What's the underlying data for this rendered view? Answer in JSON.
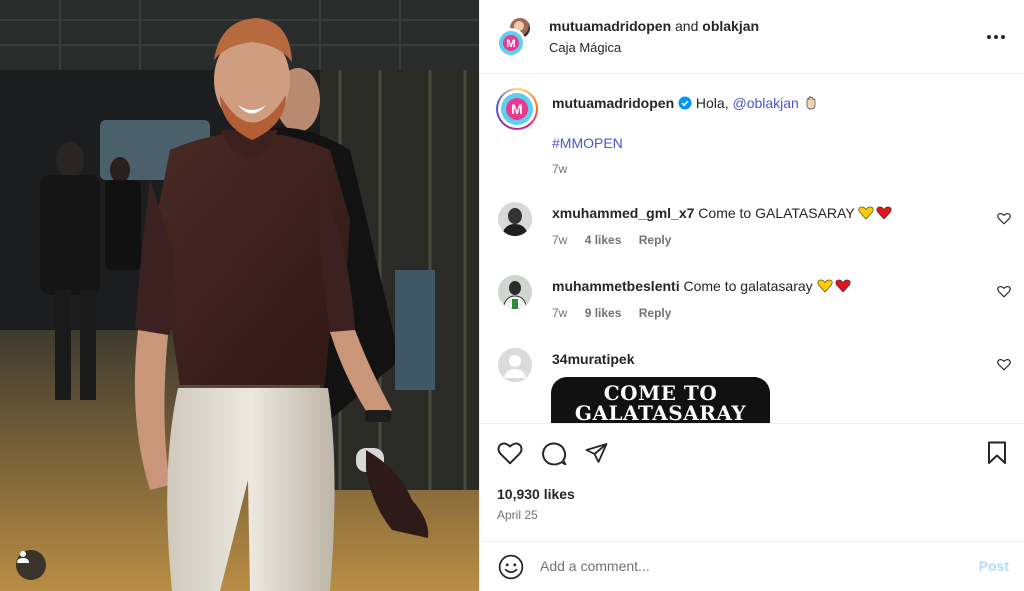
{
  "header": {
    "author1": "mutuamadridopen",
    "connector": "and",
    "author2": "oblakjan",
    "location": "Caja Mágica"
  },
  "caption": {
    "username": "mutuamadridopen",
    "text_before": "Hola,",
    "mention": "@oblakjan",
    "hashtag": "#MMOPEN",
    "time": "7w"
  },
  "comments": [
    {
      "username": "xmuhammed_gml_x7",
      "text": "Come to GALATASARAY",
      "time": "7w",
      "likes": "4 likes",
      "reply": "Reply"
    },
    {
      "username": "muhammetbeslenti",
      "text": "Come to galatasaray",
      "time": "7w",
      "likes": "9 likes",
      "reply": "Reply"
    },
    {
      "username": "34muratipek",
      "image_text_line1": "COME TO",
      "image_text_line2": "GALATASARAY"
    }
  ],
  "post": {
    "likes": "10,930 likes",
    "date": "April 25"
  },
  "add_comment": {
    "placeholder": "Add a comment...",
    "post_label": "Post"
  },
  "icons": {
    "like": "heart-icon",
    "comment": "comment-icon",
    "share": "paper-plane-icon",
    "save": "bookmark-icon",
    "emoji": "smiley-icon",
    "tags": "user-tag-icon",
    "more": "more-options-icon"
  },
  "colors": {
    "link": "#4b55c8",
    "muted": "#737373",
    "post_disabled": "#b3dbff",
    "verified": "#0095f6"
  }
}
